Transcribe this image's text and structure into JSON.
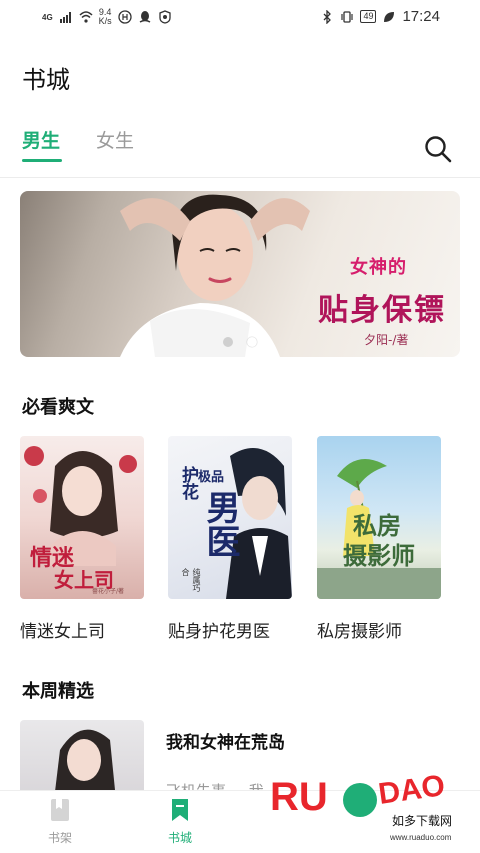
{
  "status_bar": {
    "signal": "4G",
    "speed_value": "9.4",
    "speed_unit": "K/s",
    "battery": "49",
    "time": "17:24"
  },
  "header": {
    "title": "书城"
  },
  "tabs": [
    {
      "label": "男生",
      "active": true
    },
    {
      "label": "女生",
      "active": false
    }
  ],
  "banner": {
    "title_top": "女神的",
    "title_main": "贴身保镖",
    "author": "夕阳-/著",
    "dots": [
      {
        "active": false
      },
      {
        "active": true
      }
    ]
  },
  "sections": {
    "must_read": {
      "title": "必看爽文",
      "books": [
        {
          "title": "情迷女上司",
          "cover_text_a": "情迷",
          "cover_text_b": "女上司",
          "cover_author": "蔷花小子/著"
        },
        {
          "title": "贴身护花男医",
          "cover_text_a": "护花",
          "cover_text_b": "极品",
          "cover_text_c": "男医",
          "cover_sub": "纯属巧合"
        },
        {
          "title": "私房摄影师",
          "cover_text_a": "私房",
          "cover_text_b": "摄影师"
        }
      ]
    },
    "weekly": {
      "title": "本周精选",
      "item": {
        "title": "我和女神在荒岛",
        "meta_a": "飞机失事",
        "meta_b": "我"
      }
    }
  },
  "bottom_nav": [
    {
      "label": "书架",
      "active": false,
      "icon": "bookshelf-icon"
    },
    {
      "label": "书城",
      "active": true,
      "icon": "bookstore-icon"
    }
  ],
  "watermark": {
    "brand": "RUANDAO",
    "cn": "如多下载网",
    "url": "www.ruaduo.com"
  },
  "colors": {
    "accent": "#1fae77",
    "inactive": "#9a9a9a",
    "banner_title": "#b0145a"
  }
}
